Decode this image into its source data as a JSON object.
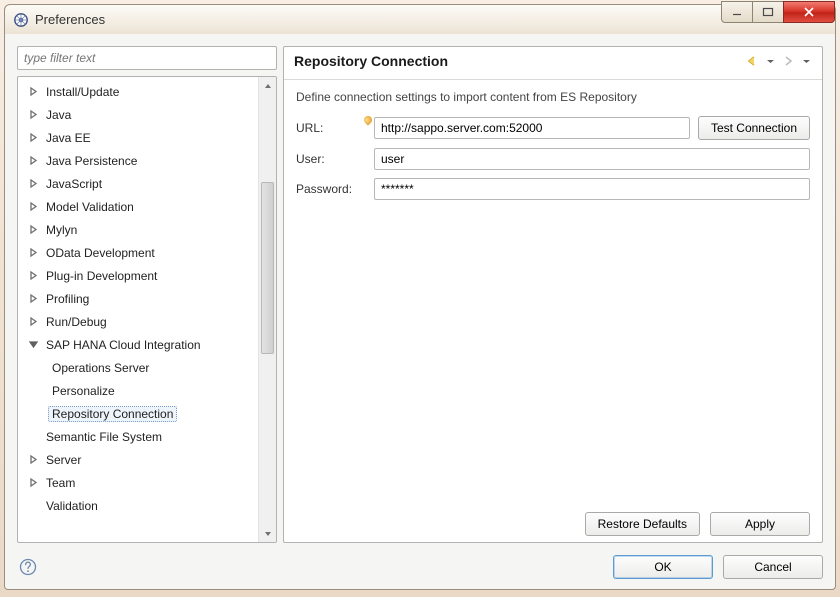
{
  "window": {
    "title": "Preferences"
  },
  "filter": {
    "placeholder": "type filter text"
  },
  "tree": {
    "items": [
      {
        "label": "Install/Update",
        "kind": "collapsed",
        "level": 0
      },
      {
        "label": "Java",
        "kind": "collapsed",
        "level": 0
      },
      {
        "label": "Java EE",
        "kind": "collapsed",
        "level": 0
      },
      {
        "label": "Java Persistence",
        "kind": "collapsed",
        "level": 0
      },
      {
        "label": "JavaScript",
        "kind": "collapsed",
        "level": 0
      },
      {
        "label": "Model Validation",
        "kind": "collapsed",
        "level": 0
      },
      {
        "label": "Mylyn",
        "kind": "collapsed",
        "level": 0
      },
      {
        "label": "OData Development",
        "kind": "collapsed",
        "level": 0
      },
      {
        "label": "Plug-in Development",
        "kind": "collapsed",
        "level": 0
      },
      {
        "label": "Profiling",
        "kind": "collapsed",
        "level": 0
      },
      {
        "label": "Run/Debug",
        "kind": "collapsed",
        "level": 0
      },
      {
        "label": "SAP HANA Cloud Integration",
        "kind": "expanded",
        "level": 0
      },
      {
        "label": "Operations Server",
        "kind": "leaf",
        "level": 1
      },
      {
        "label": "Personalize",
        "kind": "leaf",
        "level": 1
      },
      {
        "label": "Repository Connection",
        "kind": "leaf",
        "level": 1,
        "selected": true
      },
      {
        "label": "Semantic File System",
        "kind": "leaf",
        "level": 0
      },
      {
        "label": "Server",
        "kind": "collapsed",
        "level": 0
      },
      {
        "label": "Team",
        "kind": "collapsed",
        "level": 0
      },
      {
        "label": "Validation",
        "kind": "leaf",
        "level": 0
      }
    ]
  },
  "page": {
    "title": "Repository Connection",
    "description": "Define connection settings to import content from ES Repository",
    "url": {
      "label": "URL:",
      "value": "http://sappo.server.com:52000"
    },
    "user": {
      "label": "User:",
      "value": "user"
    },
    "password": {
      "label": "Password:",
      "value": "*******"
    },
    "testConnection": "Test Connection",
    "restoreDefaults": "Restore Defaults",
    "apply": "Apply"
  },
  "dialog": {
    "ok": "OK",
    "cancel": "Cancel"
  }
}
